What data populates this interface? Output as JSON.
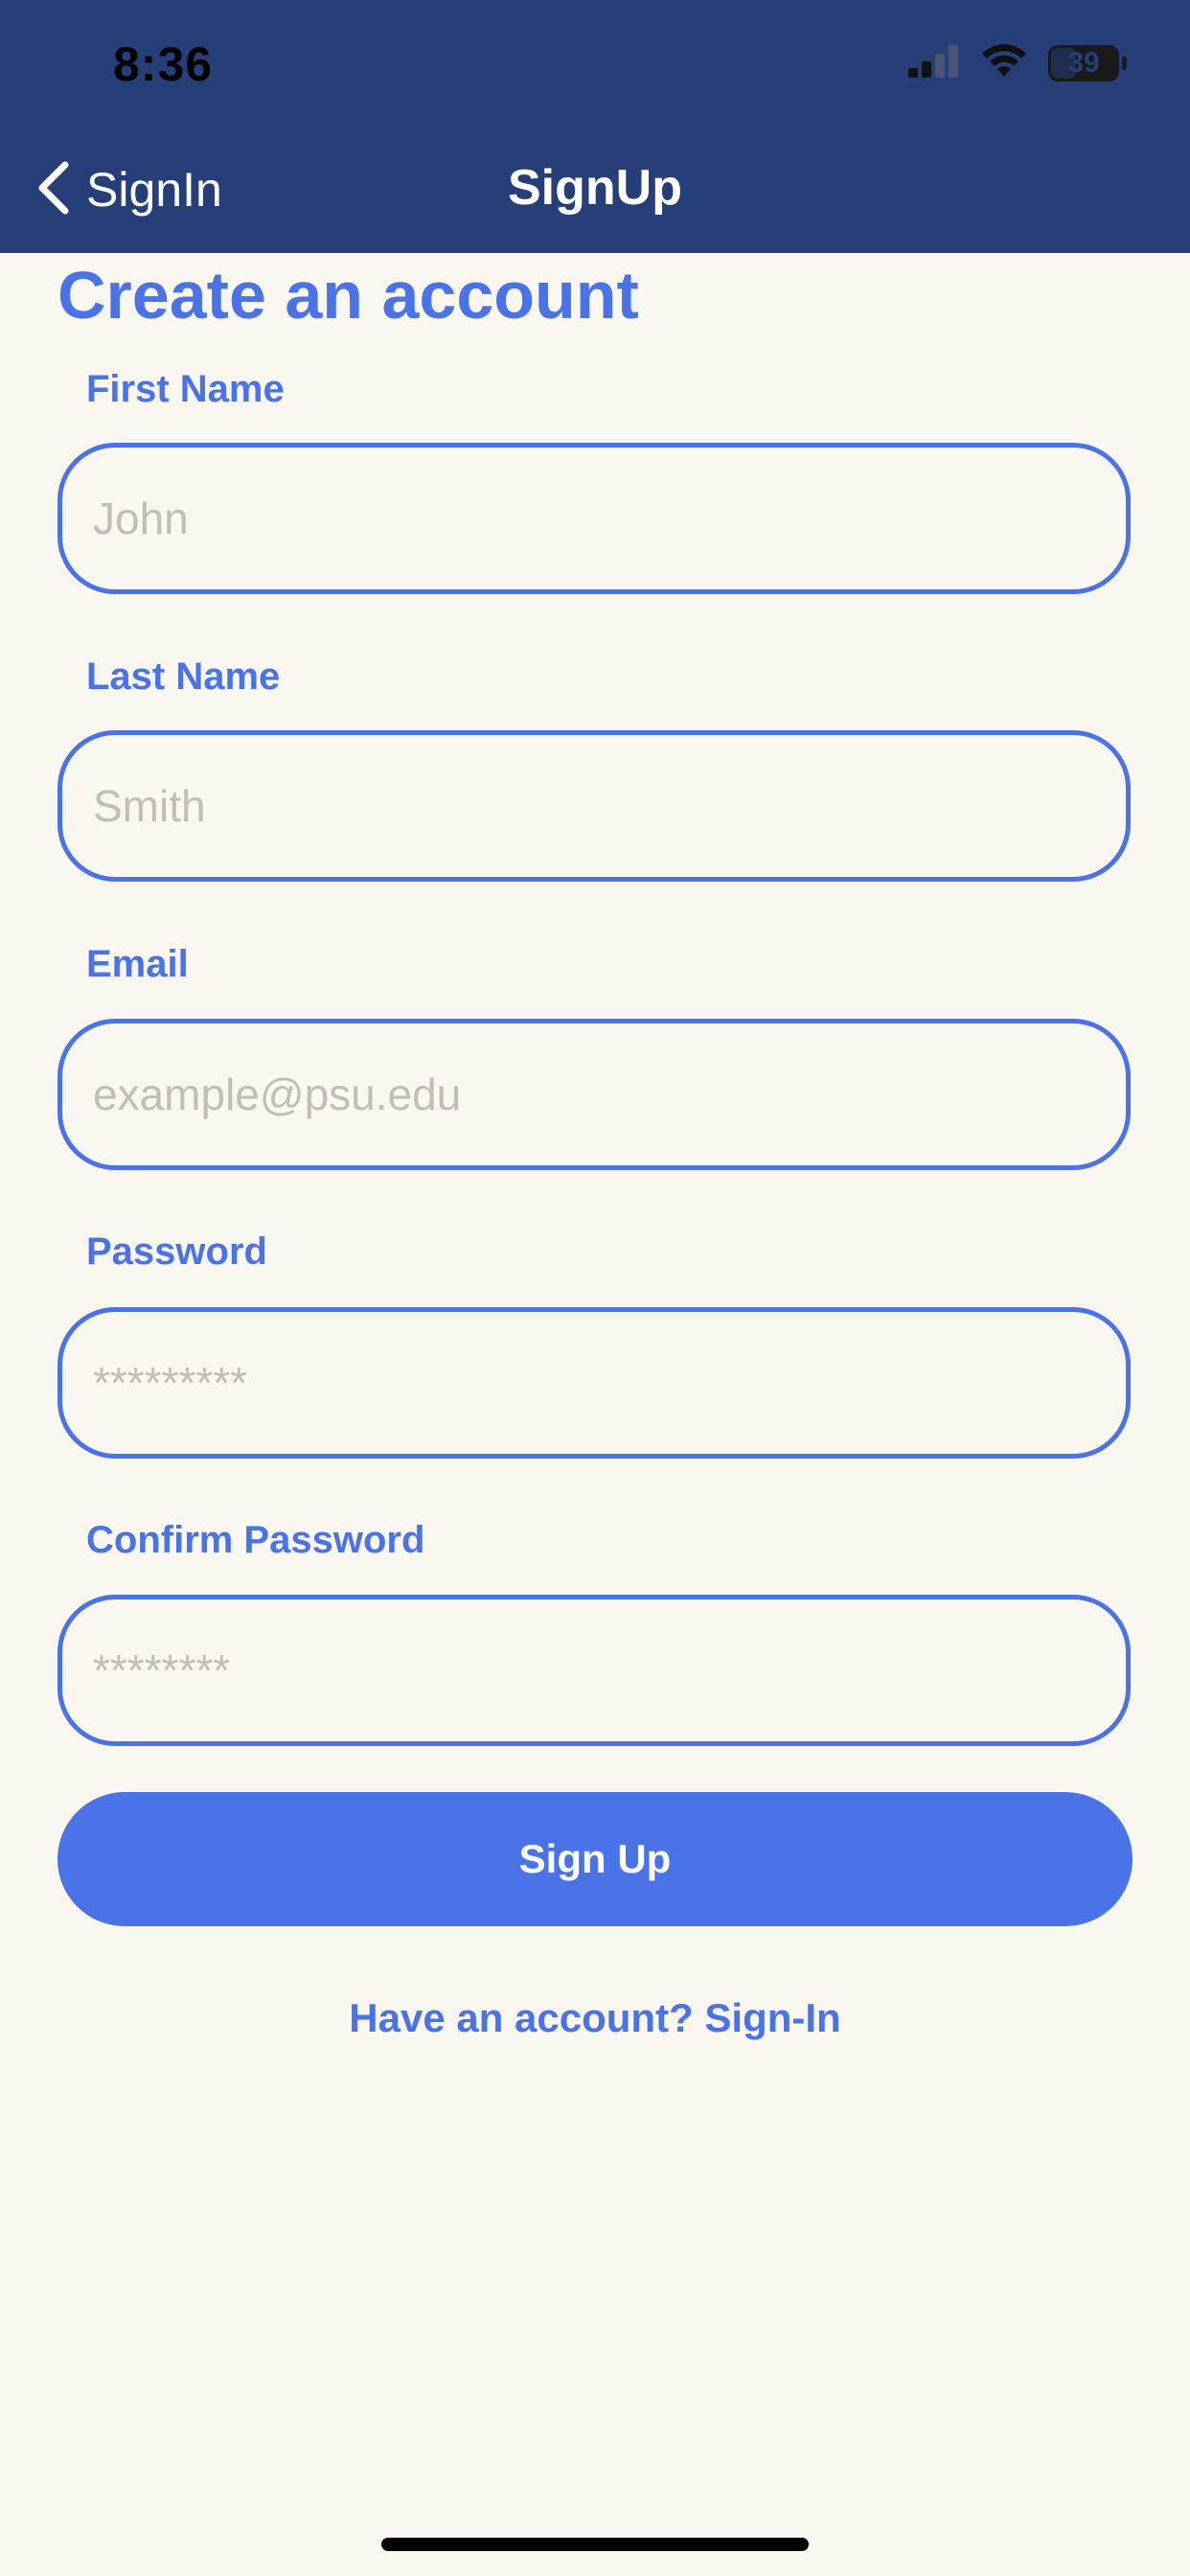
{
  "status_bar": {
    "time": "8:36",
    "battery_level": "39"
  },
  "nav": {
    "back_label": "SignIn",
    "title": "SignUp"
  },
  "form": {
    "heading": "Create an account",
    "first_name": {
      "label": "First Name",
      "placeholder": "John",
      "value": ""
    },
    "last_name": {
      "label": "Last Name",
      "placeholder": "Smith",
      "value": ""
    },
    "email": {
      "label": "Email",
      "placeholder": "example@psu.edu",
      "value": ""
    },
    "password": {
      "label": "Password",
      "placeholder": "*********",
      "value": ""
    },
    "confirm_password": {
      "label": "Confirm Password",
      "placeholder": "********",
      "value": ""
    },
    "submit_label": "Sign Up",
    "signin_link": "Have an account? Sign-In"
  },
  "colors": {
    "header_bg": "#263f78",
    "accent": "#4a73e8",
    "background": "#faf6f0",
    "placeholder": "#c2bdb6"
  },
  "icons": {
    "back": "chevron-left-icon",
    "signal": "cellular-signal-icon",
    "wifi": "wifi-icon",
    "battery": "battery-icon"
  }
}
